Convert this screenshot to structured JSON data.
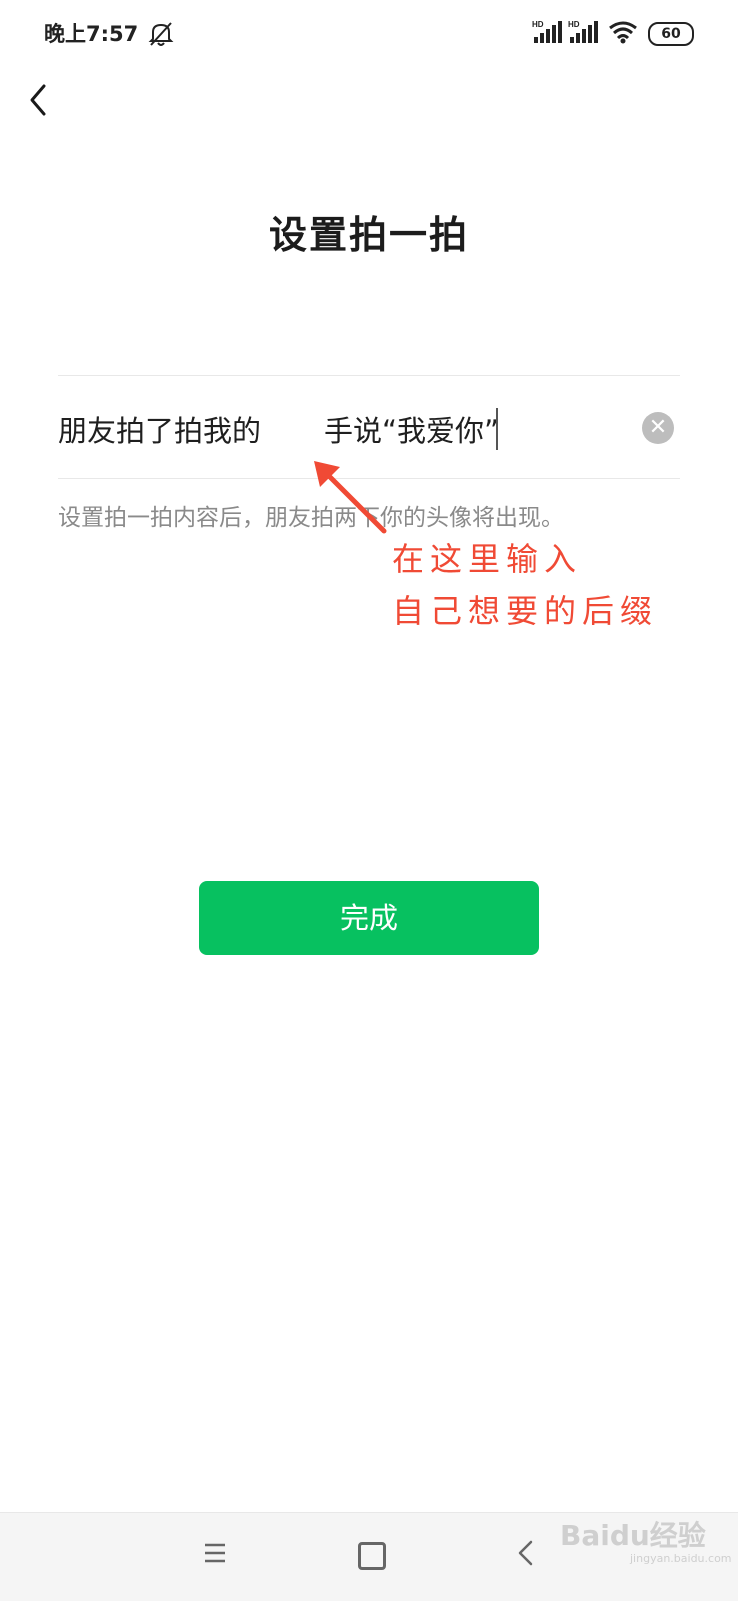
{
  "status_bar": {
    "time": "晚上7:57",
    "signal1_label": "HD",
    "signal2_label": "HD",
    "battery": "60",
    "icons": [
      "bell-muted-icon",
      "signal-icon",
      "signal-icon",
      "wifi-icon",
      "battery-icon"
    ]
  },
  "header": {
    "back_icon": "chevron-left-icon",
    "title": "设置拍一拍"
  },
  "pat_input": {
    "prefix": "朋友拍了拍我的",
    "value": "手说“我爱你”",
    "clear_icon": "close-circle-icon"
  },
  "hint": "设置拍一拍内容后，朋友拍两下你的头像将出现。",
  "annotation": {
    "line1": "在这里输入",
    "line2": "自己想要的后缀",
    "color": "#f04a35"
  },
  "done_button": {
    "label": "完成",
    "color": "#07c160"
  },
  "nav_bar": {
    "icons": [
      "menu-icon",
      "home-icon",
      "back-icon"
    ]
  },
  "watermark": {
    "text": "Baidu经验",
    "sub": "jingyan.baidu.com"
  }
}
